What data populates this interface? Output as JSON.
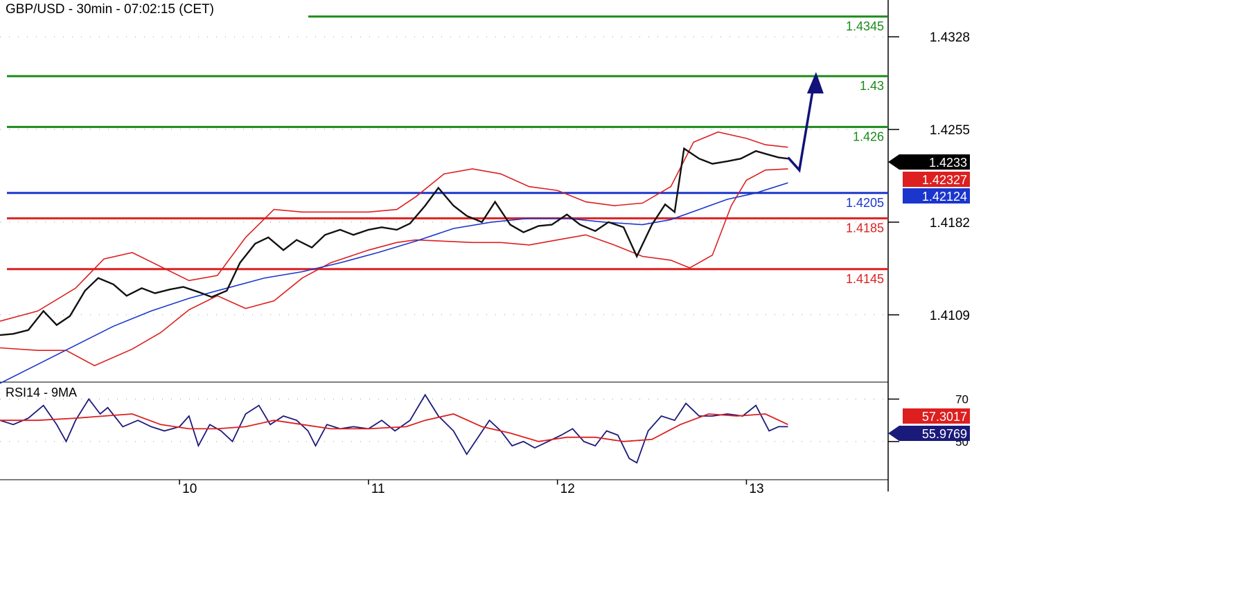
{
  "chart_data": [
    {
      "type": "line",
      "title": "GBP/USD - 30min - 07:02:15 (CET)",
      "price_axis": {
        "ticks": [
          "1.4328",
          "1.4255",
          "1.4182",
          "1.4109"
        ],
        "ylim": [
          1.4056,
          1.4357
        ]
      },
      "x_axis": {
        "ticks": [
          "10",
          "11",
          "12",
          "13"
        ],
        "tick_positions": [
          10,
          11,
          12,
          13
        ],
        "xlim": [
          9.05,
          13.75
        ]
      },
      "levels": [
        {
          "label": "1.4345",
          "value": 1.4344,
          "color": "#1a8a1a",
          "kind": "resistance"
        },
        {
          "label": "1.43",
          "value": 1.4297,
          "color": "#1a8a1a",
          "kind": "resistance"
        },
        {
          "label": "1.426",
          "value": 1.4257,
          "color": "#1a8a1a",
          "kind": "resistance"
        },
        {
          "label": "1.4205",
          "value": 1.4205,
          "color": "#1a36cc",
          "kind": "pivot"
        },
        {
          "label": "1.4185",
          "value": 1.4185,
          "color": "#dd1f1f",
          "kind": "support"
        },
        {
          "label": "1.4145",
          "value": 1.4145,
          "color": "#dd1f1f",
          "kind": "support"
        }
      ],
      "price_tags": [
        {
          "label": "1.4233",
          "value": 1.4233,
          "color": "#000000"
        },
        {
          "label": "1.42327",
          "value": 1.42327,
          "color": "#dd1f1f"
        },
        {
          "label": "1.42124",
          "value": 1.42124,
          "color": "#1a36cc"
        }
      ],
      "price_series": [
        [
          9.05,
          1.4093
        ],
        [
          9.12,
          1.4094
        ],
        [
          9.2,
          1.4097
        ],
        [
          9.28,
          1.4112
        ],
        [
          9.35,
          1.4101
        ],
        [
          9.42,
          1.4108
        ],
        [
          9.5,
          1.4128
        ],
        [
          9.57,
          1.4138
        ],
        [
          9.65,
          1.4133
        ],
        [
          9.72,
          1.4124
        ],
        [
          9.8,
          1.413
        ],
        [
          9.87,
          1.4126
        ],
        [
          9.95,
          1.4129
        ],
        [
          10.02,
          1.4131
        ],
        [
          10.1,
          1.4127
        ],
        [
          10.17,
          1.4123
        ],
        [
          10.25,
          1.4128
        ],
        [
          10.32,
          1.415
        ],
        [
          10.4,
          1.4165
        ],
        [
          10.47,
          1.417
        ],
        [
          10.55,
          1.416
        ],
        [
          10.62,
          1.4168
        ],
        [
          10.7,
          1.4162
        ],
        [
          10.77,
          1.4172
        ],
        [
          10.85,
          1.4176
        ],
        [
          10.92,
          1.4172
        ],
        [
          11.0,
          1.4176
        ],
        [
          11.07,
          1.4178
        ],
        [
          11.15,
          1.4176
        ],
        [
          11.22,
          1.4181
        ],
        [
          11.3,
          1.4195
        ],
        [
          11.37,
          1.4209
        ],
        [
          11.45,
          1.4195
        ],
        [
          11.52,
          1.4187
        ],
        [
          11.6,
          1.4182
        ],
        [
          11.67,
          1.4198
        ],
        [
          11.75,
          1.418
        ],
        [
          11.82,
          1.4174
        ],
        [
          11.9,
          1.4179
        ],
        [
          11.97,
          1.418
        ],
        [
          12.05,
          1.4188
        ],
        [
          12.12,
          1.418
        ],
        [
          12.2,
          1.4175
        ],
        [
          12.27,
          1.4182
        ],
        [
          12.35,
          1.4178
        ],
        [
          12.42,
          1.4155
        ],
        [
          12.5,
          1.418
        ],
        [
          12.57,
          1.4196
        ],
        [
          12.62,
          1.419
        ],
        [
          12.67,
          1.424
        ],
        [
          12.75,
          1.4232
        ],
        [
          12.82,
          1.4228
        ],
        [
          12.9,
          1.423
        ],
        [
          12.97,
          1.4232
        ],
        [
          13.05,
          1.4238
        ],
        [
          13.12,
          1.4235
        ],
        [
          13.17,
          1.4233
        ],
        [
          13.22,
          1.4232
        ]
      ],
      "bollinger_upper": [
        [
          9.05,
          1.4104
        ],
        [
          9.25,
          1.4112
        ],
        [
          9.45,
          1.413
        ],
        [
          9.6,
          1.4153
        ],
        [
          9.75,
          1.4158
        ],
        [
          9.9,
          1.4147
        ],
        [
          10.05,
          1.4136
        ],
        [
          10.2,
          1.414
        ],
        [
          10.35,
          1.417
        ],
        [
          10.5,
          1.4192
        ],
        [
          10.65,
          1.419
        ],
        [
          10.8,
          1.419
        ],
        [
          11.0,
          1.419
        ],
        [
          11.15,
          1.4192
        ],
        [
          11.25,
          1.4202
        ],
        [
          11.4,
          1.422
        ],
        [
          11.55,
          1.4224
        ],
        [
          11.7,
          1.422
        ],
        [
          11.85,
          1.421
        ],
        [
          12.0,
          1.4207
        ],
        [
          12.15,
          1.4198
        ],
        [
          12.3,
          1.4195
        ],
        [
          12.45,
          1.4197
        ],
        [
          12.6,
          1.421
        ],
        [
          12.72,
          1.4245
        ],
        [
          12.85,
          1.4253
        ],
        [
          13.0,
          1.4248
        ],
        [
          13.1,
          1.4243
        ],
        [
          13.22,
          1.4241
        ]
      ],
      "bollinger_lower": [
        [
          9.05,
          1.4083
        ],
        [
          9.25,
          1.4081
        ],
        [
          9.4,
          1.4081
        ],
        [
          9.55,
          1.4069
        ],
        [
          9.75,
          1.4082
        ],
        [
          9.9,
          1.4095
        ],
        [
          10.05,
          1.4113
        ],
        [
          10.2,
          1.4124
        ],
        [
          10.35,
          1.4114
        ],
        [
          10.5,
          1.412
        ],
        [
          10.65,
          1.4138
        ],
        [
          10.8,
          1.415
        ],
        [
          11.0,
          1.416
        ],
        [
          11.15,
          1.4166
        ],
        [
          11.25,
          1.4168
        ],
        [
          11.4,
          1.4167
        ],
        [
          11.55,
          1.4166
        ],
        [
          11.7,
          1.4166
        ],
        [
          11.85,
          1.4164
        ],
        [
          12.0,
          1.4168
        ],
        [
          12.15,
          1.4172
        ],
        [
          12.3,
          1.4164
        ],
        [
          12.45,
          1.4155
        ],
        [
          12.6,
          1.4152
        ],
        [
          12.7,
          1.4146
        ],
        [
          12.82,
          1.4156
        ],
        [
          12.92,
          1.4195
        ],
        [
          13.0,
          1.4215
        ],
        [
          13.1,
          1.4223
        ],
        [
          13.22,
          1.4224
        ]
      ],
      "moving_average": [
        [
          9.05,
          1.4055
        ],
        [
          9.25,
          1.407
        ],
        [
          9.45,
          1.4085
        ],
        [
          9.65,
          1.41
        ],
        [
          9.85,
          1.4112
        ],
        [
          10.05,
          1.4122
        ],
        [
          10.25,
          1.413
        ],
        [
          10.45,
          1.4138
        ],
        [
          10.65,
          1.4143
        ],
        [
          10.85,
          1.415
        ],
        [
          11.05,
          1.4158
        ],
        [
          11.25,
          1.4167
        ],
        [
          11.45,
          1.4177
        ],
        [
          11.65,
          1.4182
        ],
        [
          11.85,
          1.4185
        ],
        [
          12.05,
          1.4185
        ],
        [
          12.25,
          1.4182
        ],
        [
          12.45,
          1.418
        ],
        [
          12.6,
          1.4184
        ],
        [
          12.75,
          1.4192
        ],
        [
          12.9,
          1.42
        ],
        [
          13.05,
          1.4205
        ],
        [
          13.22,
          1.4213
        ]
      ],
      "forecast_arrow": [
        [
          13.22,
          1.4233
        ],
        [
          13.28,
          1.4223
        ],
        [
          13.35,
          1.4285
        ]
      ]
    },
    {
      "type": "line",
      "title": "RSI14 - 9MA",
      "yticks": [
        "70",
        "50"
      ],
      "ylim": [
        32,
        78
      ],
      "value_tags": [
        {
          "label": "57.3017",
          "value": 57.3017,
          "color": "#dd1f1f"
        },
        {
          "label": "55.9769",
          "value": 55.9769,
          "color": "#1a1a7a"
        }
      ],
      "series": [
        {
          "color": "#1a1a7a",
          "values": [
            [
              9.05,
              60
            ],
            [
              9.12,
              58
            ],
            [
              9.2,
              61
            ],
            [
              9.28,
              67
            ],
            [
              9.35,
              58
            ],
            [
              9.4,
              50
            ],
            [
              9.45,
              60
            ],
            [
              9.52,
              70
            ],
            [
              9.58,
              63
            ],
            [
              9.62,
              66
            ],
            [
              9.7,
              57
            ],
            [
              9.78,
              60
            ],
            [
              9.85,
              57
            ],
            [
              9.92,
              55
            ],
            [
              10.0,
              57
            ],
            [
              10.05,
              62
            ],
            [
              10.1,
              48
            ],
            [
              10.16,
              58
            ],
            [
              10.22,
              55
            ],
            [
              10.28,
              50
            ],
            [
              10.35,
              63
            ],
            [
              10.42,
              67
            ],
            [
              10.48,
              58
            ],
            [
              10.55,
              62
            ],
            [
              10.62,
              60
            ],
            [
              10.68,
              55
            ],
            [
              10.72,
              48
            ],
            [
              10.78,
              58
            ],
            [
              10.85,
              56
            ],
            [
              10.92,
              57
            ],
            [
              11.0,
              56
            ],
            [
              11.07,
              60
            ],
            [
              11.14,
              55
            ],
            [
              11.22,
              60
            ],
            [
              11.3,
              72
            ],
            [
              11.37,
              62
            ],
            [
              11.45,
              55
            ],
            [
              11.52,
              44
            ],
            [
              11.58,
              52
            ],
            [
              11.64,
              60
            ],
            [
              11.7,
              55
            ],
            [
              11.76,
              48
            ],
            [
              11.82,
              50
            ],
            [
              11.88,
              47
            ],
            [
              11.95,
              50
            ],
            [
              12.02,
              53
            ],
            [
              12.08,
              56
            ],
            [
              12.14,
              50
            ],
            [
              12.2,
              48
            ],
            [
              12.26,
              55
            ],
            [
              12.32,
              53
            ],
            [
              12.38,
              42
            ],
            [
              12.42,
              40
            ],
            [
              12.48,
              55
            ],
            [
              12.55,
              62
            ],
            [
              12.62,
              60
            ],
            [
              12.68,
              68
            ],
            [
              12.75,
              62
            ],
            [
              12.82,
              62
            ],
            [
              12.9,
              63
            ],
            [
              12.98,
              62
            ],
            [
              13.05,
              67
            ],
            [
              13.12,
              55
            ],
            [
              13.17,
              57
            ],
            [
              13.22,
              57
            ]
          ]
        },
        {
          "color": "#dd1f1f",
          "values": [
            [
              9.05,
              60
            ],
            [
              9.25,
              60
            ],
            [
              9.45,
              61
            ],
            [
              9.6,
              62
            ],
            [
              9.75,
              63
            ],
            [
              9.9,
              58
            ],
            [
              10.05,
              56
            ],
            [
              10.2,
              56
            ],
            [
              10.35,
              57
            ],
            [
              10.5,
              60
            ],
            [
              10.65,
              58
            ],
            [
              10.8,
              56
            ],
            [
              11.0,
              56
            ],
            [
              11.2,
              57
            ],
            [
              11.3,
              60
            ],
            [
              11.45,
              63
            ],
            [
              11.6,
              57
            ],
            [
              11.75,
              54
            ],
            [
              11.9,
              50
            ],
            [
              12.05,
              52
            ],
            [
              12.2,
              52
            ],
            [
              12.35,
              50
            ],
            [
              12.5,
              51
            ],
            [
              12.65,
              58
            ],
            [
              12.8,
              63
            ],
            [
              12.95,
              62
            ],
            [
              13.1,
              63
            ],
            [
              13.22,
              58
            ]
          ]
        }
      ]
    }
  ]
}
